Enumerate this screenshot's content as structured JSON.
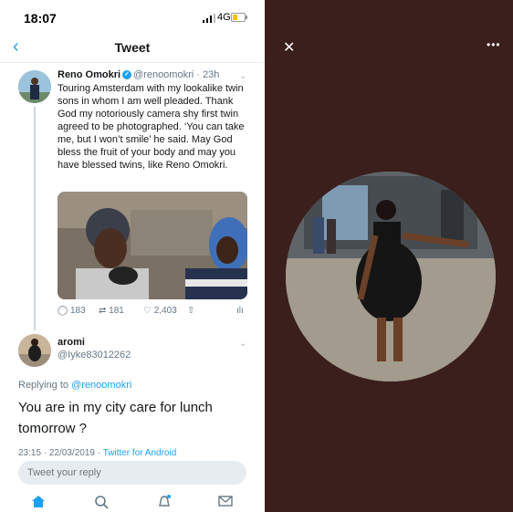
{
  "status_bar": {
    "time": "18:07",
    "network": "4G"
  },
  "nav": {
    "title": "Tweet"
  },
  "tweet": {
    "name": "Reno Omokri",
    "handle": "@renoomokri",
    "age": "· 23h",
    "text": "Touring Amsterdam with my lookalike twin sons in whom I am well pleaded. Thank God my notoriously camera shy first twin agreed to be photographed. ‘You can take me, but I won’t smile’ he said. May God bless the fruit of your body and may you have blessed twins, like Reno Omokri.",
    "replies": "183",
    "retweets": "181",
    "likes": "2,403"
  },
  "reply": {
    "name": "aromi",
    "handle": "@Iyke83012262",
    "replying_label": "Replying to",
    "replying_handle": "@renoomokri",
    "text": "You are in my city care for lunch tomorrow ?",
    "timestamp": "23:15 · 22/03/2019 ·",
    "source": "Twitter for Android"
  },
  "compose": {
    "placeholder": "Tweet your reply"
  },
  "viewer": {
    "close_icon": "close-icon",
    "more_icon": "more-icon"
  },
  "colors": {
    "accent": "#1da1f2",
    "viewer_bg": "#3a1f1c"
  }
}
